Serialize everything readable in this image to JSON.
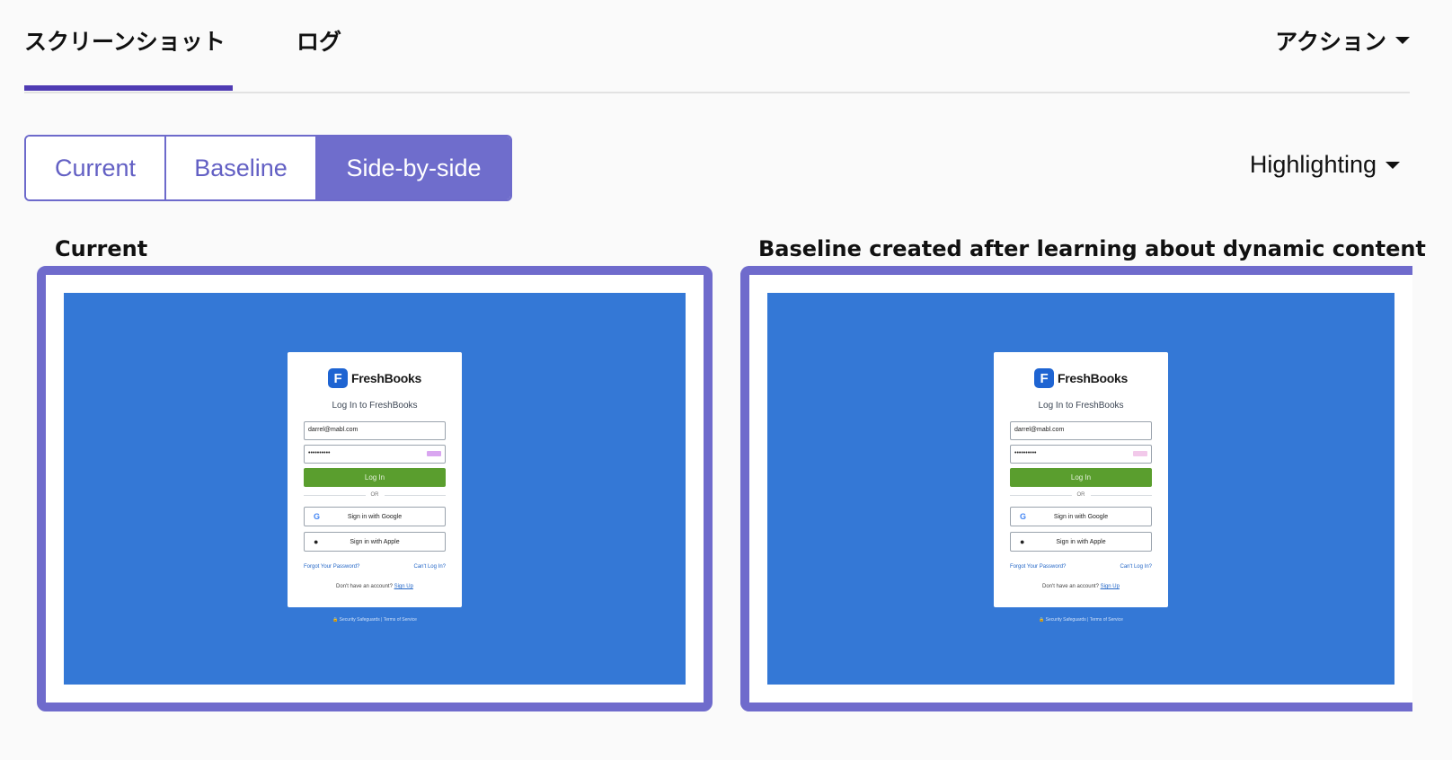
{
  "tabs": {
    "screenshot": "スクリーンショット",
    "log": "ログ",
    "actions": "アクション"
  },
  "view_toggle": {
    "current": "Current",
    "baseline": "Baseline",
    "side_by_side": "Side-by-side",
    "selected": "Side-by-side"
  },
  "highlighting": "Highlighting",
  "panes": [
    {
      "title": "Current",
      "password_badge": "dark"
    },
    {
      "title": "Baseline created after learning about dynamic content",
      "password_badge": "light"
    }
  ],
  "login_card": {
    "logo_mark": "F",
    "logo_text": "FreshBooks",
    "heading": "Log In to FreshBooks",
    "email": "darrel@mabl.com",
    "password": "••••••••••",
    "login_button": "Log In",
    "or": "OR",
    "google": "Sign in with Google",
    "apple": "Sign in with Apple",
    "google_icon": "G",
    "apple_icon": "",
    "forgot": "Forgot Your Password?",
    "cant_login": "Can't Log In?",
    "no_account": "Don't have an account?",
    "sign_up": "Sign Up",
    "footer": "🔒 Security Safeguards | Terms of Service"
  },
  "colors": {
    "accent": "#6f6dcc",
    "underline": "#4f3bb3",
    "screenshot_bg": "#3478d6",
    "login_green": "#5a9e2e"
  }
}
